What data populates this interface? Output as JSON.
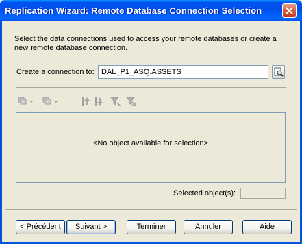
{
  "window": {
    "title": "Replication Wizard: Remote Database Connection Selection"
  },
  "intro_text": "Select the data connections used to access your remote databases or create a new remote database connection.",
  "connection": {
    "label": "Create a connection to:",
    "value": "DAL_P1_ASQ.ASSETS"
  },
  "list": {
    "empty_message": "<No object available for selection>"
  },
  "selected": {
    "label": "Selected object(s):",
    "value": ""
  },
  "buttons": {
    "back": "< Précédent",
    "next": "Suivant >",
    "finish": "Terminer",
    "cancel": "Annuler",
    "help": "Aide"
  },
  "icons": {
    "close": "close-icon",
    "browse": "browse-icon",
    "toolbar": [
      "select-all-icon",
      "deselect-all-icon",
      "move-up-icon",
      "move-down-icon",
      "filter-icon",
      "clear-filter-icon"
    ]
  }
}
